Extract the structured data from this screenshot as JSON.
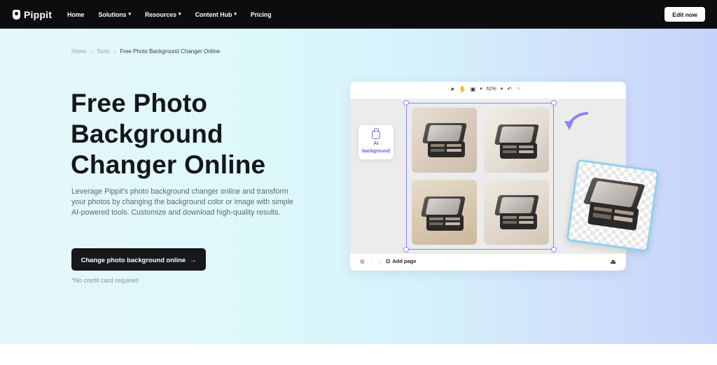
{
  "brand": {
    "name": "Pippit"
  },
  "nav": {
    "items": [
      {
        "label": "Home",
        "has_dropdown": false
      },
      {
        "label": "Solutions",
        "has_dropdown": true
      },
      {
        "label": "Resources",
        "has_dropdown": true
      },
      {
        "label": "Content Hub",
        "has_dropdown": true
      },
      {
        "label": "Pricing",
        "has_dropdown": false
      }
    ],
    "edit_label": "Edit now"
  },
  "breadcrumb": {
    "items": [
      "Home",
      "Tools"
    ],
    "current": "Free Photo Background Changer Online",
    "separator": "›"
  },
  "hero": {
    "title_line1": "Free Photo",
    "title_line2": "Background",
    "title_line3": "Changer Online",
    "description": "Leverage Pippit's photo background changer online and transform your photos by changing the background color or image with simple AI-powered tools. Customize and download high-quality results.",
    "cta_label": "Change photo background online",
    "cta_arrow": "→",
    "note": "*No credit card required"
  },
  "editor": {
    "zoom": "62%",
    "ai_badge_line1": "AI",
    "ai_badge_line2": "background",
    "add_page_label": "Add page"
  },
  "colors": {
    "topbar": "#0d0d0f",
    "accent": "#7a6ff0",
    "cta_bg": "#17181b",
    "selection": "#8e86f5",
    "result_border": "#8fd2f0"
  },
  "icons": {
    "pointer": "cursor-icon",
    "hand": "hand-icon",
    "frame": "frame-icon",
    "undo": "undo-icon",
    "redo": "redo-icon",
    "layers": "layers-icon",
    "add_page": "add-page-icon",
    "export": "export-icon"
  }
}
